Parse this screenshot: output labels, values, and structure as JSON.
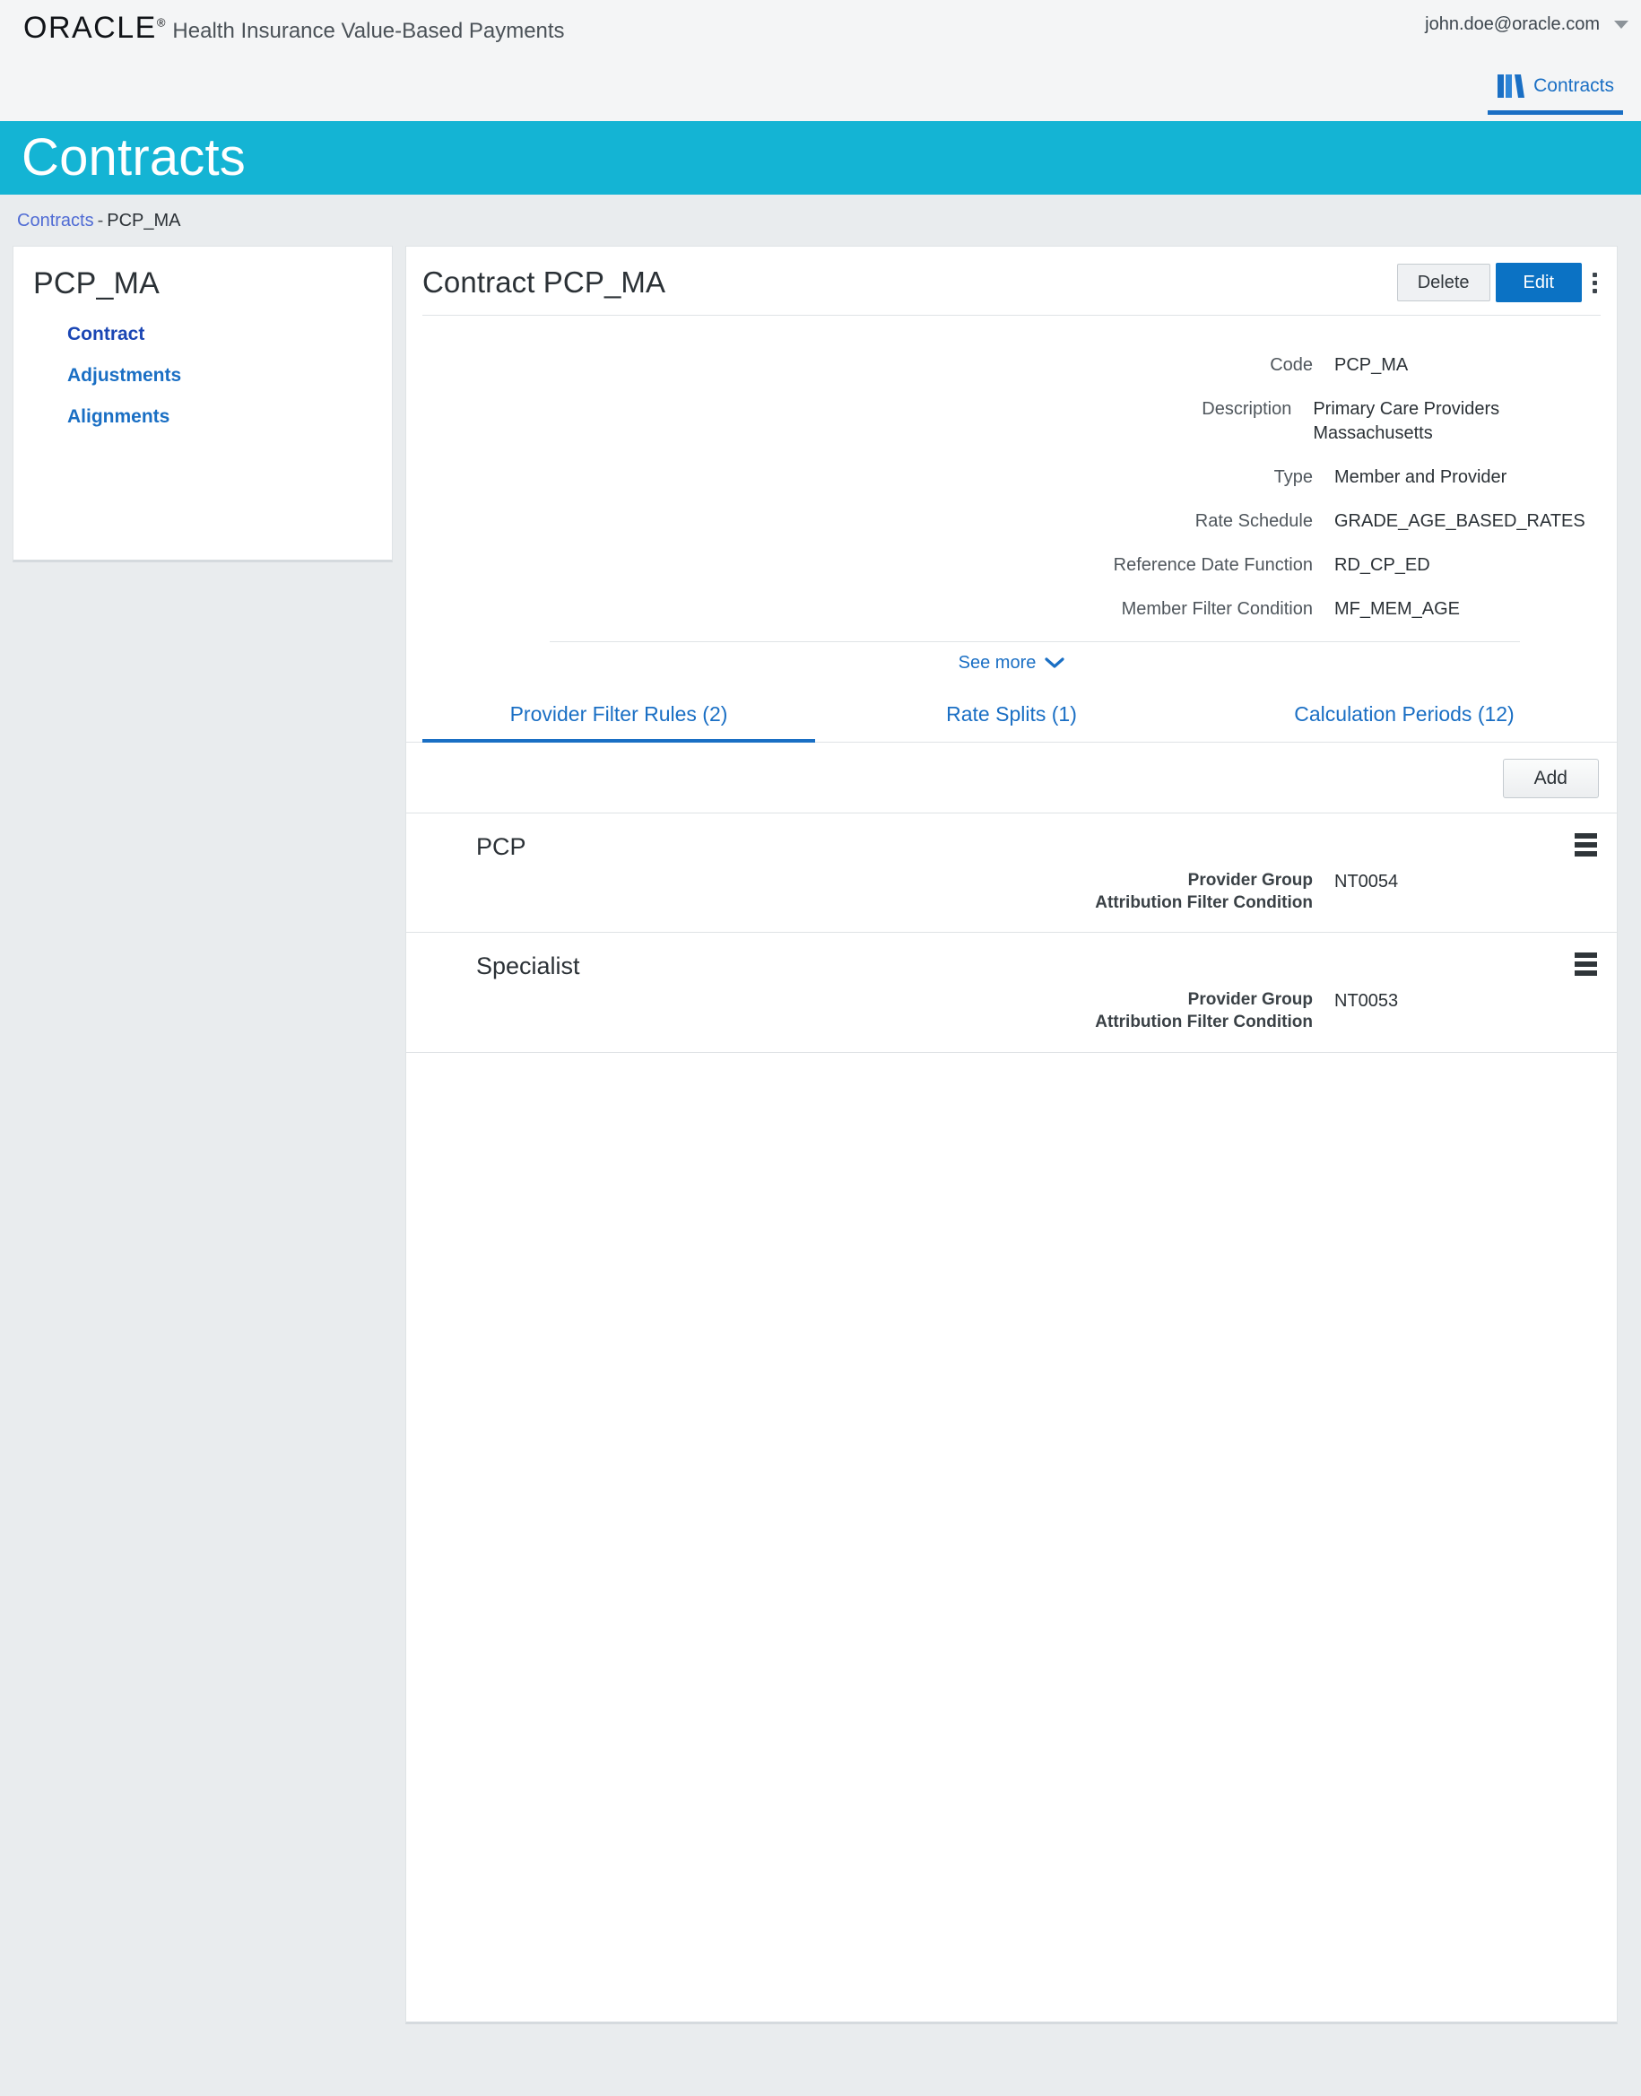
{
  "topbar": {
    "logo_text": "ORACLE",
    "logo_reg": "®",
    "app_name": "Health Insurance Value-Based Payments",
    "user_email": "john.doe@oracle.com",
    "user_menu_icon": "caret-down-icon"
  },
  "nav": {
    "items": [
      {
        "label": "Contracts",
        "icon": "books-icon",
        "active": true
      }
    ]
  },
  "banner": {
    "title": "Contracts",
    "color": "#14b4d4"
  },
  "breadcrumb": {
    "root": "Contracts",
    "separator": "-",
    "current": "PCP_MA"
  },
  "sidebar": {
    "title": "PCP_MA",
    "items": [
      {
        "label": "Contract",
        "active": true
      },
      {
        "label": "Adjustments",
        "active": false
      },
      {
        "label": "Alignments",
        "active": false
      }
    ]
  },
  "main": {
    "title": "Contract PCP_MA",
    "actions": {
      "delete_label": "Delete",
      "edit_label": "Edit",
      "overflow_icon": "kebab-menu-icon"
    },
    "fields": [
      {
        "label": "Code",
        "value": "PCP_MA"
      },
      {
        "label": "Description",
        "value": "Primary Care Providers Massachusetts"
      },
      {
        "label": "Type",
        "value": "Member and Provider"
      },
      {
        "label": "Rate Schedule",
        "value": "GRADE_AGE_BASED_RATES"
      },
      {
        "label": "Reference Date Function",
        "value": "RD_CP_ED"
      },
      {
        "label": "Member Filter Condition",
        "value": "MF_MEM_AGE"
      }
    ],
    "see_more_label": "See more",
    "see_more_icon": "chevron-down-icon",
    "tabs": [
      {
        "label": "Provider Filter Rules (2)",
        "active": true
      },
      {
        "label": "Rate Splits (1)",
        "active": false
      },
      {
        "label": "Calculation Periods (12)",
        "active": false
      }
    ],
    "toolbar": {
      "add_label": "Add"
    },
    "rules": [
      {
        "title": "PCP",
        "field_label_line1": "Provider Group",
        "field_label_line2": "Attribution Filter Condition",
        "field_value": "NT0054",
        "menu_icon": "hamburger-menu-icon"
      },
      {
        "title": "Specialist",
        "field_label_line1": "Provider Group",
        "field_label_line2": "Attribution Filter Condition",
        "field_value": "NT0053",
        "menu_icon": "hamburger-menu-icon"
      }
    ]
  },
  "colors": {
    "banner_teal": "#14b4d4",
    "primary_blue": "#0b72c4",
    "link_blue": "#1a6fc4",
    "backdrop_gray": "#e9ecee"
  }
}
